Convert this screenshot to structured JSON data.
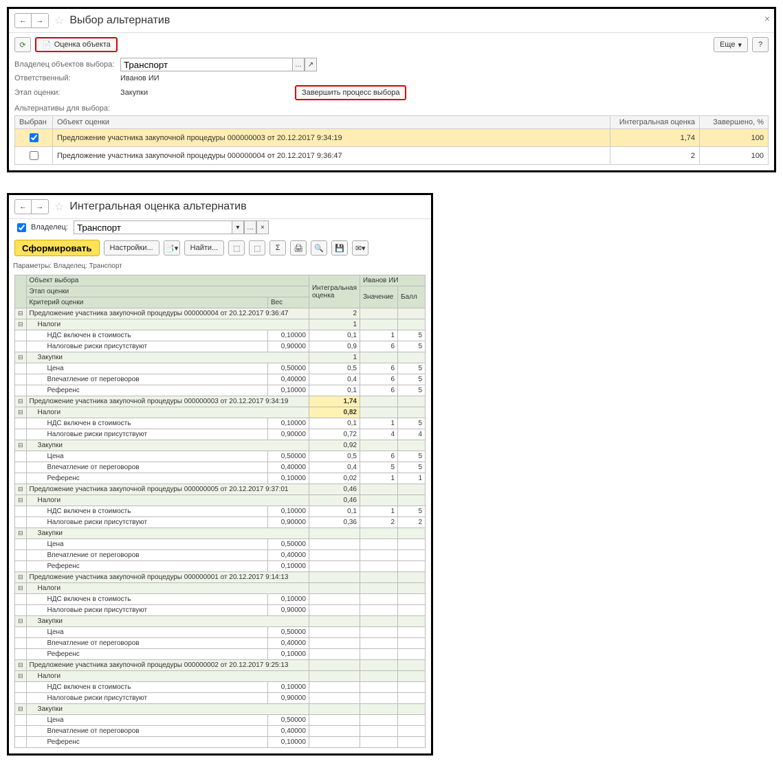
{
  "panel1": {
    "title": "Выбор альтернатив",
    "refresh": "↻",
    "eval_btn": "Оценка объекта",
    "more_btn": "Еще",
    "help_btn": "?",
    "owner_label": "Владелец объектов выбора:",
    "owner_value": "Транспорт",
    "resp_label": "Ответственный:",
    "resp_value": "Иванов ИИ",
    "stage_label": "Этап оценки:",
    "stage_value": "Закупки",
    "finish_btn": "Завершить процесс выбора",
    "alt_label": "Альтернативы для выбора:",
    "cols": {
      "sel": "Выбран",
      "obj": "Объект оценки",
      "score": "Интегральная оценка",
      "done": "Завершено, %"
    },
    "rows": [
      {
        "sel": true,
        "obj": "Предложение участника закупочной процедуры 000000003 от 20.12.2017 9:34:19",
        "score": "1,74",
        "done": "100"
      },
      {
        "sel": false,
        "obj": "Предложение участника закупочной процедуры 000000004 от 20.12.2017 9:36:47",
        "score": "2",
        "done": "100"
      }
    ]
  },
  "panel2": {
    "title": "Интегральная оценка альтернатив",
    "owner_chk_label": "Владелец:",
    "owner_value": "Транспорт",
    "form_btn": "Сформировать",
    "settings_btn": "Настройки...",
    "find_btn": "Найти...",
    "params_label": "Параметры:",
    "params_val": "Владелец: Транспорт",
    "hd_obj": "Объект выбора",
    "hd_user": "Иванов ИИ",
    "hd_stage": "Этап оценки",
    "hd_int": "Интегральная оценка",
    "hd_val": "Значение",
    "hd_ball": "Балл",
    "hd_crit": "Критерий оценки",
    "hd_wt": "Вес",
    "rows": [
      {
        "t": "grp",
        "n": "Предложение участника закупочной процедуры 000000004 от 20.12.2017 9:36:47",
        "int": "2"
      },
      {
        "t": "sub",
        "n": "Налоги",
        "int": "1"
      },
      {
        "t": "row",
        "n": "НДС включен в стоимость",
        "w": "0,10000",
        "int": "0,1",
        "v": "1",
        "b": "5"
      },
      {
        "t": "row",
        "n": "Налоговые риски присутствуют",
        "w": "0,90000",
        "int": "0,9",
        "v": "6",
        "b": "5"
      },
      {
        "t": "sub",
        "n": "Закупки",
        "int": "1"
      },
      {
        "t": "row",
        "n": "Цена",
        "w": "0,50000",
        "int": "0,5",
        "v": "6",
        "b": "5"
      },
      {
        "t": "row",
        "n": "Впечатление от переговоров",
        "w": "0,40000",
        "int": "0,4",
        "v": "6",
        "b": "5"
      },
      {
        "t": "row",
        "n": "Референс",
        "w": "0,10000",
        "int": "0,1",
        "v": "6",
        "b": "5"
      },
      {
        "t": "hi",
        "n": "Предложение участника закупочной процедуры 000000003 от 20.12.2017 9:34:19",
        "int": "1,74"
      },
      {
        "t": "hi2",
        "n": "Налоги",
        "int": "0,82"
      },
      {
        "t": "row",
        "n": "НДС включен в стоимость",
        "w": "0,10000",
        "int": "0,1",
        "v": "1",
        "b": "5"
      },
      {
        "t": "row",
        "n": "Налоговые риски присутствуют",
        "w": "0,90000",
        "int": "0,72",
        "v": "4",
        "b": "4"
      },
      {
        "t": "sub",
        "n": "Закупки",
        "int": "0,92"
      },
      {
        "t": "row",
        "n": "Цена",
        "w": "0,50000",
        "int": "0,5",
        "v": "6",
        "b": "5"
      },
      {
        "t": "row",
        "n": "Впечатление от переговоров",
        "w": "0,40000",
        "int": "0,4",
        "v": "5",
        "b": "5"
      },
      {
        "t": "row",
        "n": "Референс",
        "w": "0,10000",
        "int": "0,02",
        "v": "1",
        "b": "1"
      },
      {
        "t": "grp",
        "n": "Предложение участника закупочной процедуры 000000005 от 20.12.2017 9:37:01",
        "int": "0,46"
      },
      {
        "t": "sub",
        "n": "Налоги",
        "int": "0,46"
      },
      {
        "t": "row",
        "n": "НДС включен в стоимость",
        "w": "0,10000",
        "int": "0,1",
        "v": "1",
        "b": "5"
      },
      {
        "t": "row",
        "n": "Налоговые риски присутствуют",
        "w": "0,90000",
        "int": "0,36",
        "v": "2",
        "b": "2"
      },
      {
        "t": "sub",
        "n": "Закупки"
      },
      {
        "t": "row",
        "n": "Цена",
        "w": "0,50000"
      },
      {
        "t": "row",
        "n": "Впечатление от переговоров",
        "w": "0,40000"
      },
      {
        "t": "row",
        "n": "Референс",
        "w": "0,10000"
      },
      {
        "t": "grp",
        "n": "Предложение участника закупочной процедуры 000000001 от 20.12.2017 9:14:13"
      },
      {
        "t": "sub",
        "n": "Налоги"
      },
      {
        "t": "row",
        "n": "НДС включен в стоимость",
        "w": "0,10000"
      },
      {
        "t": "row",
        "n": "Налоговые риски присутствуют",
        "w": "0,90000"
      },
      {
        "t": "sub",
        "n": "Закупки"
      },
      {
        "t": "row",
        "n": "Цена",
        "w": "0,50000"
      },
      {
        "t": "row",
        "n": "Впечатление от переговоров",
        "w": "0,40000"
      },
      {
        "t": "row",
        "n": "Референс",
        "w": "0,10000"
      },
      {
        "t": "grp",
        "n": "Предложение участника закупочной процедуры 000000002 от 20.12.2017 9:25:13"
      },
      {
        "t": "sub",
        "n": "Налоги"
      },
      {
        "t": "row",
        "n": "НДС включен в стоимость",
        "w": "0,10000"
      },
      {
        "t": "row",
        "n": "Налоговые риски присутствуют",
        "w": "0,90000"
      },
      {
        "t": "sub",
        "n": "Закупки"
      },
      {
        "t": "row",
        "n": "Цена",
        "w": "0,50000"
      },
      {
        "t": "row",
        "n": "Впечатление от переговоров",
        "w": "0,40000"
      },
      {
        "t": "row",
        "n": "Референс",
        "w": "0,10000"
      }
    ]
  }
}
